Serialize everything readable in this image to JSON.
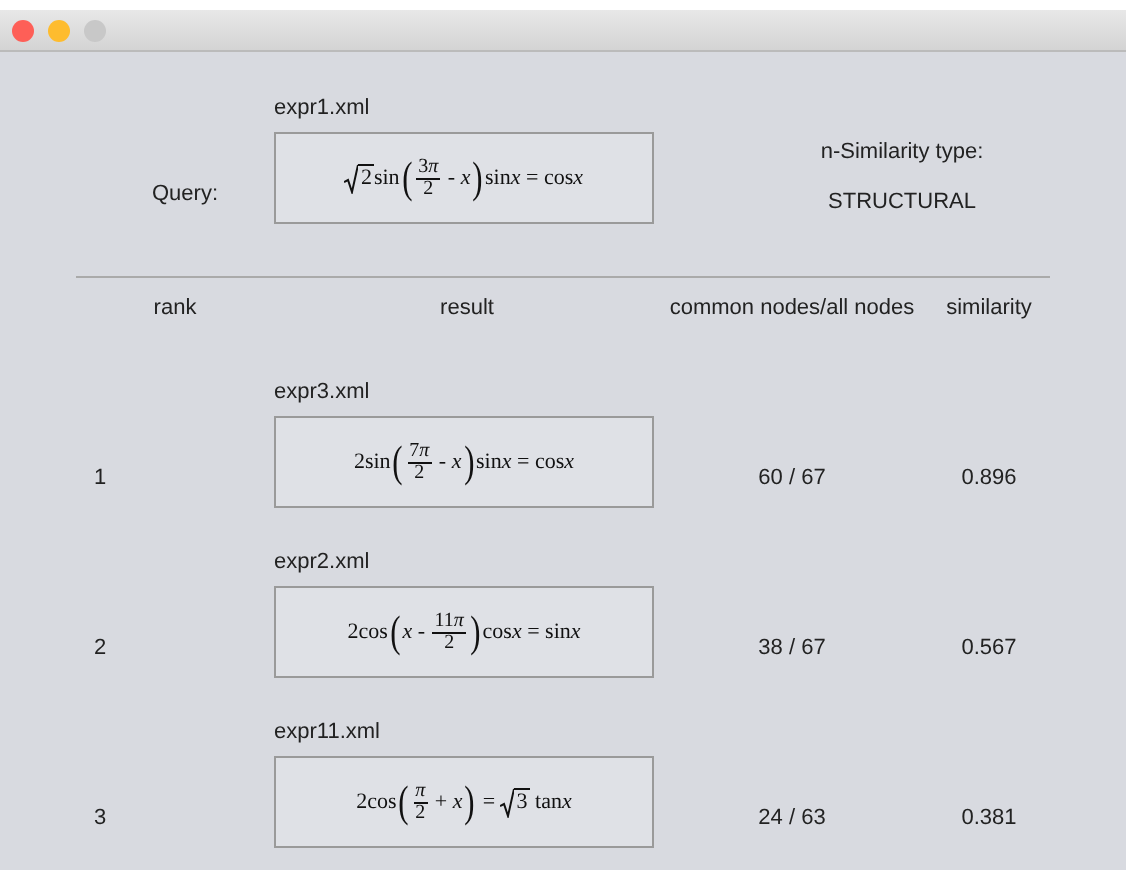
{
  "window": {
    "traffic_lights": [
      {
        "color": "#fe5f57"
      },
      {
        "color": "#febc2e"
      },
      {
        "color": "#c8c8c8"
      }
    ]
  },
  "query": {
    "label": "Query:",
    "file": "expr1.xml",
    "formula": [
      {
        "kind": "sqrt",
        "text": "2"
      },
      {
        "kind": "text",
        "text": "sin"
      },
      {
        "kind": "paren",
        "text": "("
      },
      {
        "kind": "frac",
        "num": "3",
        "num_var": "π",
        "den": "2"
      },
      {
        "kind": "text",
        "text": " - "
      },
      {
        "kind": "var",
        "text": "x"
      },
      {
        "kind": "paren",
        "text": ")"
      },
      {
        "kind": "text",
        "text": "sin"
      },
      {
        "kind": "var",
        "text": "x"
      },
      {
        "kind": "text",
        "text": " = cos"
      },
      {
        "kind": "var",
        "text": "x"
      }
    ]
  },
  "similarity_type": {
    "label": "n-Similarity type:",
    "value": "STRUCTURAL"
  },
  "table": {
    "columns": [
      "rank",
      "result",
      "common nodes/all nodes",
      "similarity"
    ],
    "rows": [
      {
        "rank": "1",
        "file": "expr3.xml",
        "nodes": "60 / 67",
        "similarity": "0.896",
        "formula": [
          {
            "kind": "text",
            "text": "2sin"
          },
          {
            "kind": "paren",
            "text": "("
          },
          {
            "kind": "frac",
            "num": "7",
            "num_var": "π",
            "den": "2"
          },
          {
            "kind": "text",
            "text": " - "
          },
          {
            "kind": "var",
            "text": "x"
          },
          {
            "kind": "paren",
            "text": ")"
          },
          {
            "kind": "text",
            "text": "sin"
          },
          {
            "kind": "var",
            "text": "x"
          },
          {
            "kind": "text",
            "text": " = cos"
          },
          {
            "kind": "var",
            "text": "x"
          }
        ]
      },
      {
        "rank": "2",
        "file": "expr2.xml",
        "nodes": "38 / 67",
        "similarity": "0.567",
        "formula": [
          {
            "kind": "text",
            "text": "2cos"
          },
          {
            "kind": "paren",
            "text": "("
          },
          {
            "kind": "var",
            "text": "x"
          },
          {
            "kind": "text",
            "text": " - "
          },
          {
            "kind": "frac",
            "num": "11",
            "num_var": "π",
            "den": "2"
          },
          {
            "kind": "paren",
            "text": ")"
          },
          {
            "kind": "text",
            "text": "cos"
          },
          {
            "kind": "var",
            "text": "x"
          },
          {
            "kind": "text",
            "text": " = sin"
          },
          {
            "kind": "var",
            "text": "x"
          }
        ]
      },
      {
        "rank": "3",
        "file": "expr11.xml",
        "nodes": "24 / 63",
        "similarity": "0.381",
        "formula": [
          {
            "kind": "text",
            "text": "2cos"
          },
          {
            "kind": "paren",
            "text": "("
          },
          {
            "kind": "frac",
            "num_var": "π",
            "den": "2"
          },
          {
            "kind": "text",
            "text": " + "
          },
          {
            "kind": "var",
            "text": "x"
          },
          {
            "kind": "paren",
            "text": ")"
          },
          {
            "kind": "text",
            "text": " = "
          },
          {
            "kind": "sqrt",
            "text": "3"
          },
          {
            "kind": "text",
            "text": " tan"
          },
          {
            "kind": "var",
            "text": "x"
          }
        ]
      }
    ]
  }
}
